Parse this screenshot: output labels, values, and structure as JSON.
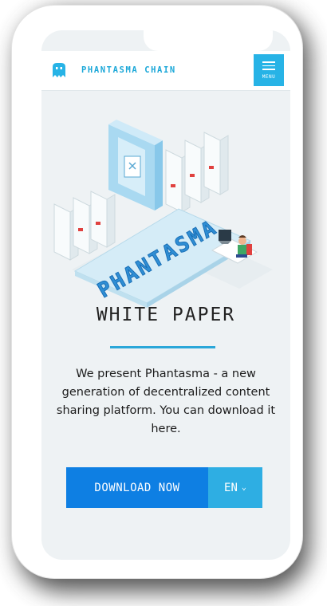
{
  "header": {
    "logo_text": "PHANTASMA CHAIN",
    "menu_label": "MENU",
    "logo_icon": "ghost-icon",
    "menu_icon": "hamburger-icon"
  },
  "hero": {
    "illustration_word": "PHANTASMA",
    "title": "WHITE PAPER",
    "description": "We present Phantasma - a new generation of decentralized content sharing platform. You can download it here."
  },
  "actions": {
    "download_label": "DOWNLOAD NOW",
    "language_value": "EN",
    "dropdown_icon": "chevron-down-icon"
  },
  "colors": {
    "accent": "#27b3e6",
    "primary_button": "#0e7fe3",
    "secondary_button": "#2eaee3",
    "logo_text": "#1aa7d8"
  }
}
